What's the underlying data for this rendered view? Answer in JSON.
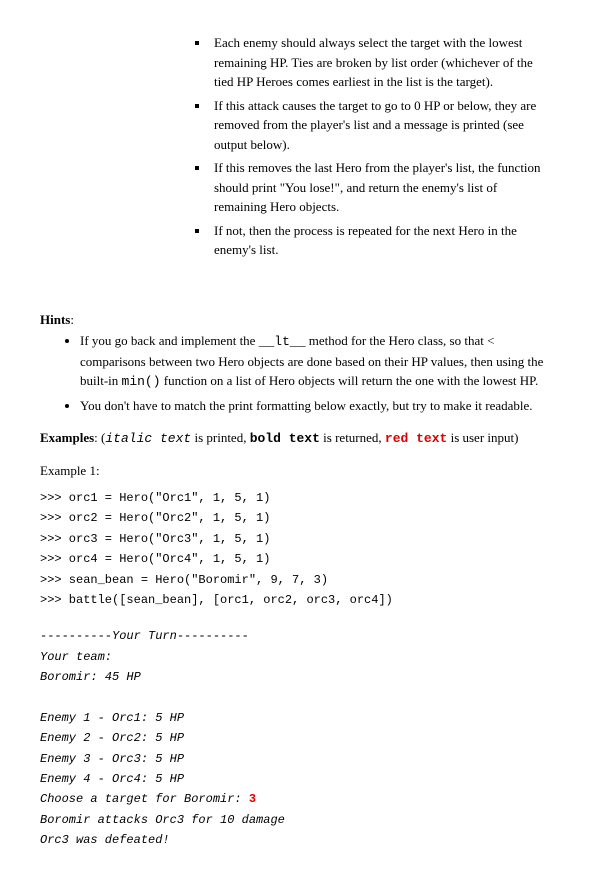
{
  "subBullets": [
    "Each enemy should always select the target with the lowest remaining HP. Ties are broken by list order (whichever of the tied HP Heroes comes earliest in the list is the target).",
    "If this attack causes the target to go to 0 HP or below, they are removed from the player's list and a message is printed (see output below).",
    "If this removes the last Hero from the player's list, the function should print \"You lose!\", and return the enemy's list of remaining Hero objects.",
    "If not, then the process is repeated for the next Hero in the enemy's list."
  ],
  "hintsLabel": "Hints",
  "hints": [
    {
      "prefix": "If you go back and implement the ",
      "code1": "__lt__",
      "mid1": " method for the Hero class, so that < comparisons between two Hero objects are done based on their HP values, then using the built-in ",
      "code2": "min()",
      "suffix": " function on a list of Hero objects will return the one with the lowest HP."
    },
    {
      "text": "You don't have to match the print formatting below exactly, but try to make it readable."
    }
  ],
  "examplesLabel": "Examples",
  "legendOpen": ": (",
  "legendItalic": "italic text",
  "legendPrinted": " is printed, ",
  "legendBold": "bold text",
  "legendReturned": " is returned, ",
  "legendRed": "red text",
  "legendUser": " is user input)",
  "exampleLabel": "Example 1:",
  "codeLines": [
    ">>> orc1 = Hero(\"Orc1\", 1, 5, 1)",
    ">>> orc2 = Hero(\"Orc2\", 1, 5, 1)",
    ">>> orc3 = Hero(\"Orc3\", 1, 5, 1)",
    ">>> orc4 = Hero(\"Orc4\", 1, 5, 1)",
    ">>> sean_bean = Hero(\"Boromir\", 9, 7, 3)",
    ">>> battle([sean_bean], [orc1, orc2, orc3, orc4])"
  ],
  "output": {
    "turnHeader": "----------Your Turn----------",
    "yourTeam": "Your team:",
    "boromir": "Boromir: 45 HP",
    "blank": "",
    "enemy1": "Enemy 1 - Orc1: 5 HP",
    "enemy2": "Enemy 2 - Orc2: 5 HP",
    "enemy3": "Enemy 3 - Orc3: 5 HP",
    "enemy4": "Enemy 4 - Orc4: 5 HP",
    "choosePrefix": "Choose a target for Boromir: ",
    "chooseInput": "3",
    "attack": "Boromir attacks Orc3 for 10 damage",
    "defeated": "Orc3 was defeated!"
  }
}
